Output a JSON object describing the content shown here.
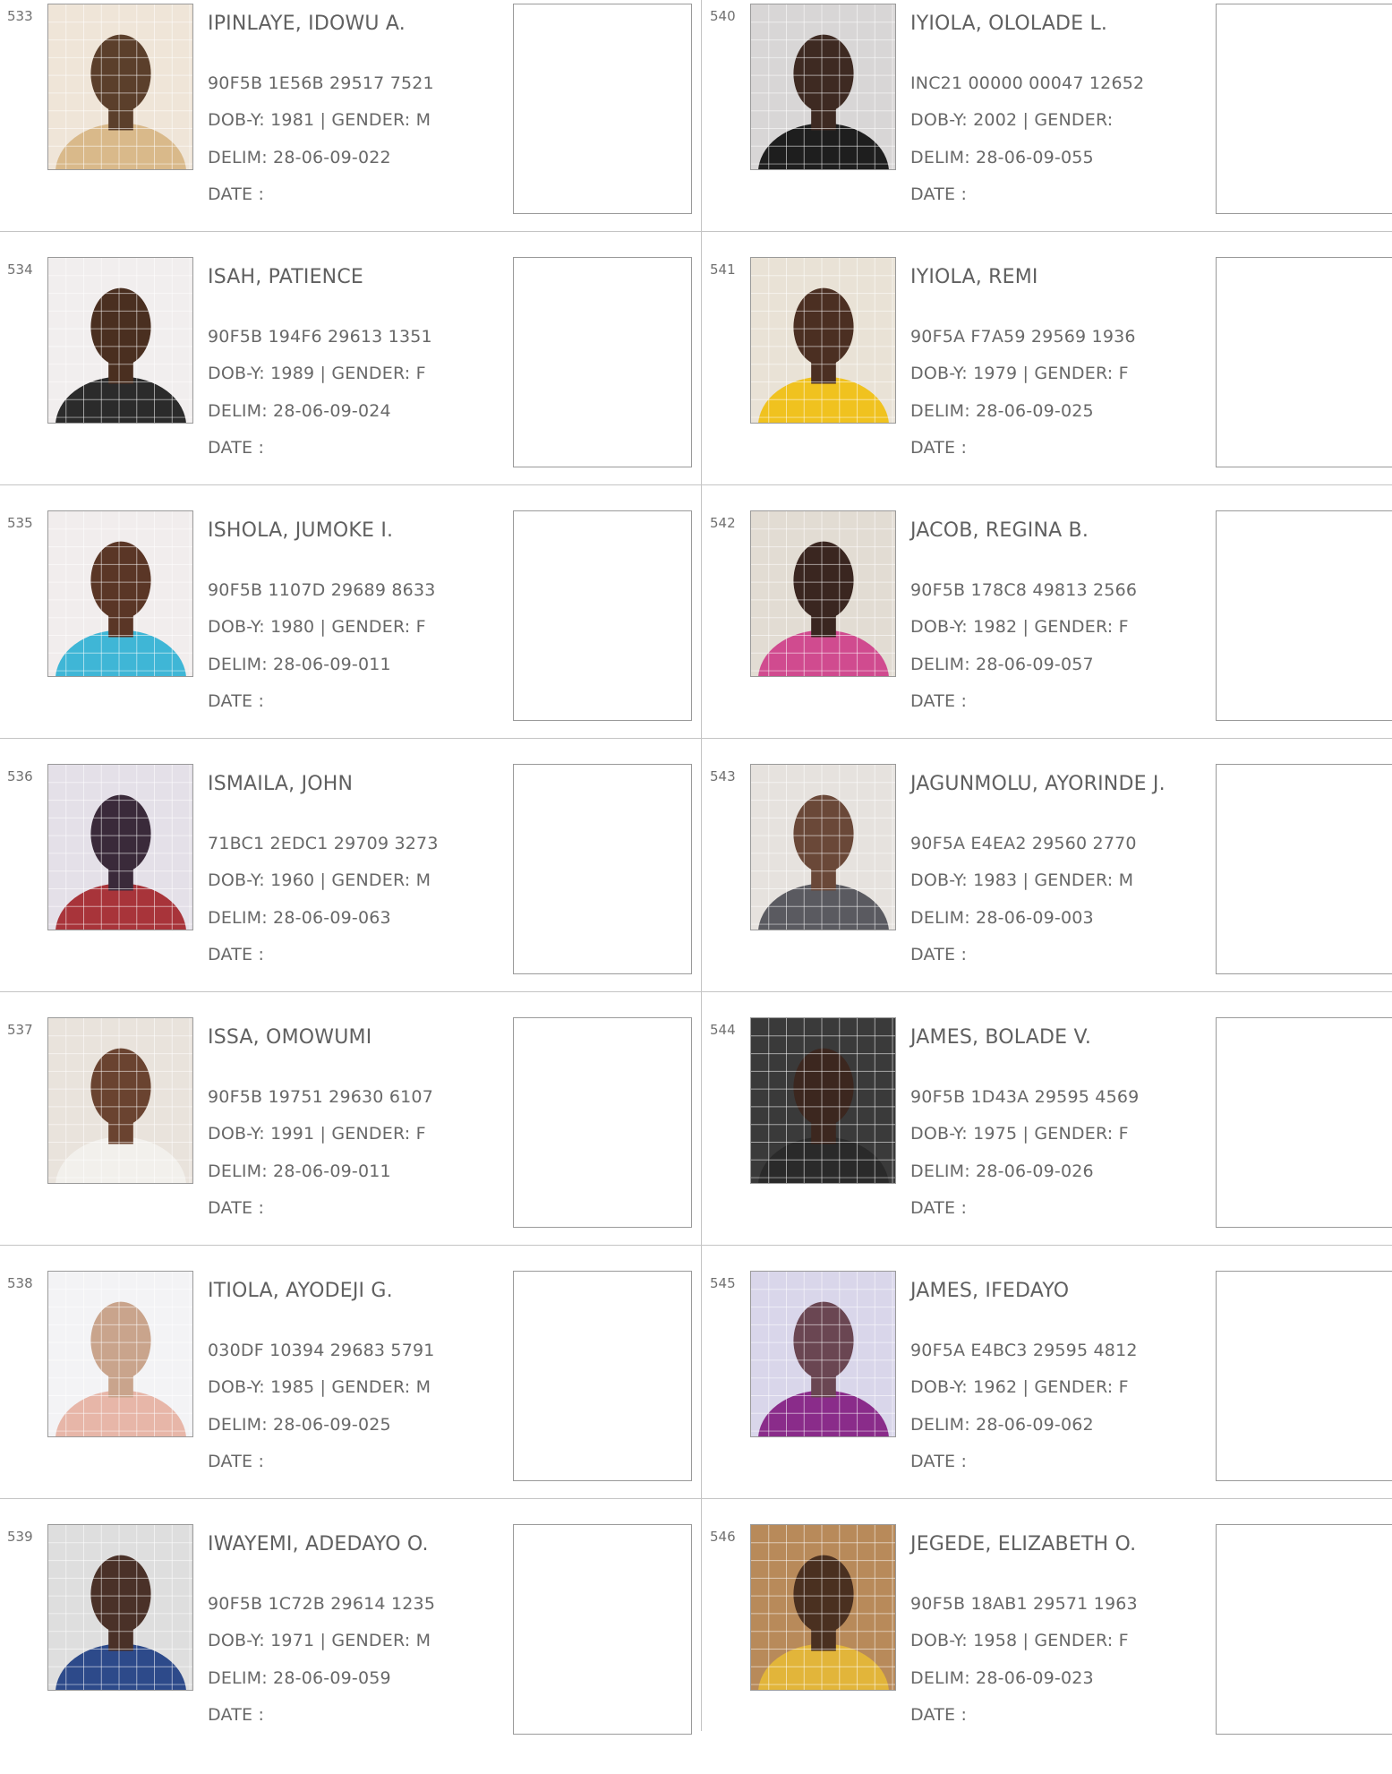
{
  "colors": {
    "text": "#6b6b6b",
    "rule": "#c4c4c4",
    "box": "#9a9a9a"
  },
  "labels": {
    "date": "DATE  :"
  },
  "entries": [
    {
      "sn": "533",
      "name": "IPINLAYE, IDOWU A.",
      "id": "90F5B 1E56B 29517 7521",
      "dobg": "DOB-Y: 1981  | GENDER: M",
      "delim": "DELIM: 28-06-09-022",
      "bg": "#efe5d8",
      "skin": "#5b3f2b",
      "cloth": "#d9b98a"
    },
    {
      "sn": "534",
      "name": "ISAH, PATIENCE",
      "id": "90F5B 194F6 29613 1351",
      "dobg": "DOB-Y: 1989  | GENDER: F",
      "delim": "DELIM: 28-06-09-024",
      "bg": "#f1eeee",
      "skin": "#4a2f20",
      "cloth": "#2b2b2b"
    },
    {
      "sn": "535",
      "name": "ISHOLA, JUMOKE I.",
      "id": "90F5B 1107D 29689 8633",
      "dobg": "DOB-Y: 1980  | GENDER: F",
      "delim": "DELIM: 28-06-09-011",
      "bg": "#f1eded",
      "skin": "#5a3626",
      "cloth": "#3fb6d6"
    },
    {
      "sn": "536",
      "name": "ISMAILA, JOHN",
      "id": "71BC1 2EDC1 29709 3273",
      "dobg": "DOB-Y: 1960  | GENDER: M",
      "delim": "DELIM: 28-06-09-063",
      "bg": "#e4e0e8",
      "skin": "#3a2a3a",
      "cloth": "#a8343a"
    },
    {
      "sn": "537",
      "name": "ISSA, OMOWUMI",
      "id": "90F5B 19751 29630 6107",
      "dobg": "DOB-Y: 1991  | GENDER: F",
      "delim": "DELIM: 28-06-09-011",
      "bg": "#e9e3dc",
      "skin": "#6a4330",
      "cloth": "#f2f0ec"
    },
    {
      "sn": "538",
      "name": "ITIOLA, AYODEJI G.",
      "id": "030DF 10394 29683 5791",
      "dobg": "DOB-Y: 1985  | GENDER: M",
      "delim": "DELIM: 28-06-09-025",
      "bg": "#f3f3f5",
      "skin": "#c9a48c",
      "cloth": "#e7b6a8"
    },
    {
      "sn": "539",
      "name": "IWAYEMI, ADEDAYO O.",
      "id": "90F5B 1C72B 29614 1235",
      "dobg": "DOB-Y: 1971  | GENDER: M",
      "delim": "DELIM: 28-06-09-059",
      "bg": "#dedede",
      "skin": "#4a3128",
      "cloth": "#2d4a8a"
    },
    {
      "sn": "540",
      "name": "IYIOLA, OLOLADE L.",
      "id": "INC21 00000 00047 12652",
      "dobg": "DOB-Y: 2002  | GENDER:",
      "delim": "DELIM: 28-06-09-055",
      "bg": "#d8d6d6",
      "skin": "#3e2a22",
      "cloth": "#1e1e1e"
    },
    {
      "sn": "541",
      "name": "IYIOLA, REMI",
      "id": "90F5A F7A59 29569 1936",
      "dobg": "DOB-Y: 1979  | GENDER: F",
      "delim": "DELIM: 28-06-09-025",
      "bg": "#e9e2d6",
      "skin": "#4b2f22",
      "cloth": "#f0c21f"
    },
    {
      "sn": "542",
      "name": "JACOB, REGINA B.",
      "id": "90F5B 178C8 49813 2566",
      "dobg": "DOB-Y: 1982  | GENDER: F",
      "delim": "DELIM: 28-06-09-057",
      "bg": "#e2dcd3",
      "skin": "#3a2620",
      "cloth": "#d04b8f"
    },
    {
      "sn": "543",
      "name": "JAGUNMOLU, AYORINDE J.",
      "id": "90F5A E4EA2 29560 2770",
      "dobg": "DOB-Y: 1983  | GENDER: M",
      "delim": "DELIM: 28-06-09-003",
      "bg": "#e6e2de",
      "skin": "#6a4838",
      "cloth": "#5a5a60"
    },
    {
      "sn": "544",
      "name": "JAMES, BOLADE V.",
      "id": "90F5B 1D43A 29595 4569",
      "dobg": "DOB-Y: 1975  | GENDER: F",
      "delim": "DELIM: 28-06-09-026",
      "bg": "#3a3a3a",
      "skin": "#3c271f",
      "cloth": "#2a2a2a"
    },
    {
      "sn": "545",
      "name": "JAMES, IFEDAYO",
      "id": "90F5A E4BC3 29595 4812",
      "dobg": "DOB-Y: 1962  | GENDER: F",
      "delim": "DELIM: 28-06-09-062",
      "bg": "#d9d6ea",
      "skin": "#6a4652",
      "cloth": "#8a2c8a"
    },
    {
      "sn": "546",
      "name": "JEGEDE, ELIZABETH O.",
      "id": "90F5B 18AB1 29571 1963",
      "dobg": "DOB-Y: 1958  | GENDER: F",
      "delim": "DELIM: 28-06-09-023",
      "bg": "#b88a5a",
      "skin": "#4a3020",
      "cloth": "#e2b53a"
    }
  ]
}
